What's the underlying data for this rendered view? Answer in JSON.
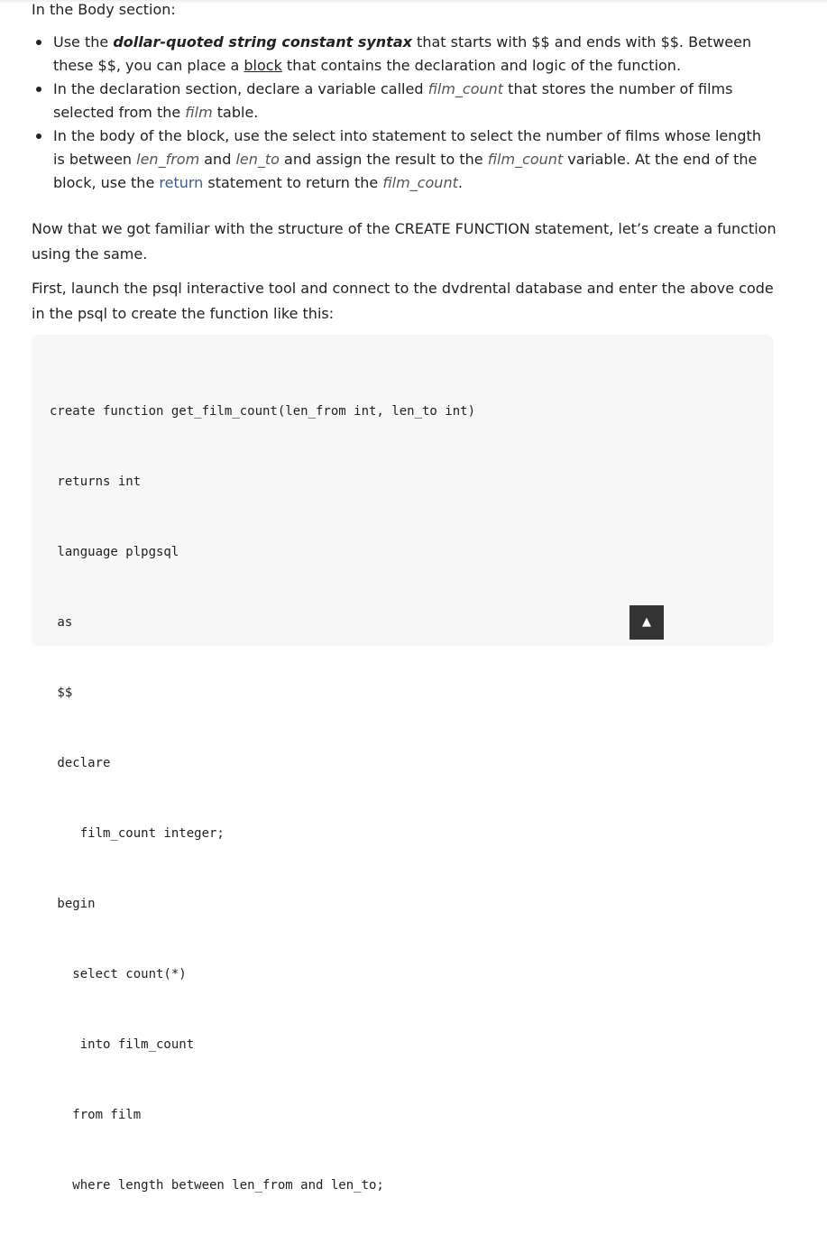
{
  "intro": "In the Body section:",
  "bullets": [
    {
      "t1": "Use the ",
      "bold": "dollar-quoted string constant syntax",
      "t2": " that starts with $$ and ends with $$. Between these $$, you can place a ",
      "link": "block",
      "t3": " that contains the declaration and logic of the function."
    },
    {
      "t1": "In the declaration section, declare a variable called ",
      "var1": "film_count",
      "t2": " that stores the number of films selected from the ",
      "var2": "film",
      "t3": " table."
    },
    {
      "t1": "In the body of the block, use the ",
      "kw1": "select into",
      "t2": " statement to select the number of films whose length is between ",
      "var1": "len_from",
      "t3": " and ",
      "var2": "len_to",
      "t4": " and assign the result to the ",
      "var3": "film_count",
      "t5": " variable. At the end of the block, use the ",
      "kw2": "return",
      "t6": " statement to return the ",
      "var4": "film_count",
      "t7": "."
    }
  ],
  "paragraphs": [
    "Now that we got familiar with the structure of the CREATE FUNCTION statement, let’s create a function using the same.",
    "First, launch the psql interactive tool and connect to the dvdrental database and enter the above code in the psql to create the function like this:"
  ],
  "code_lines": [
    "create function get_film_count(len_from int, len_to int)",
    " returns int",
    " language plpgsql",
    " as",
    " $$",
    " declare",
    "    film_count integer;",
    " begin",
    "   select count(*)",
    "    into film_count",
    "   from film",
    "   where length between len_from and len_to;"
  ],
  "back_to_top": "▲"
}
